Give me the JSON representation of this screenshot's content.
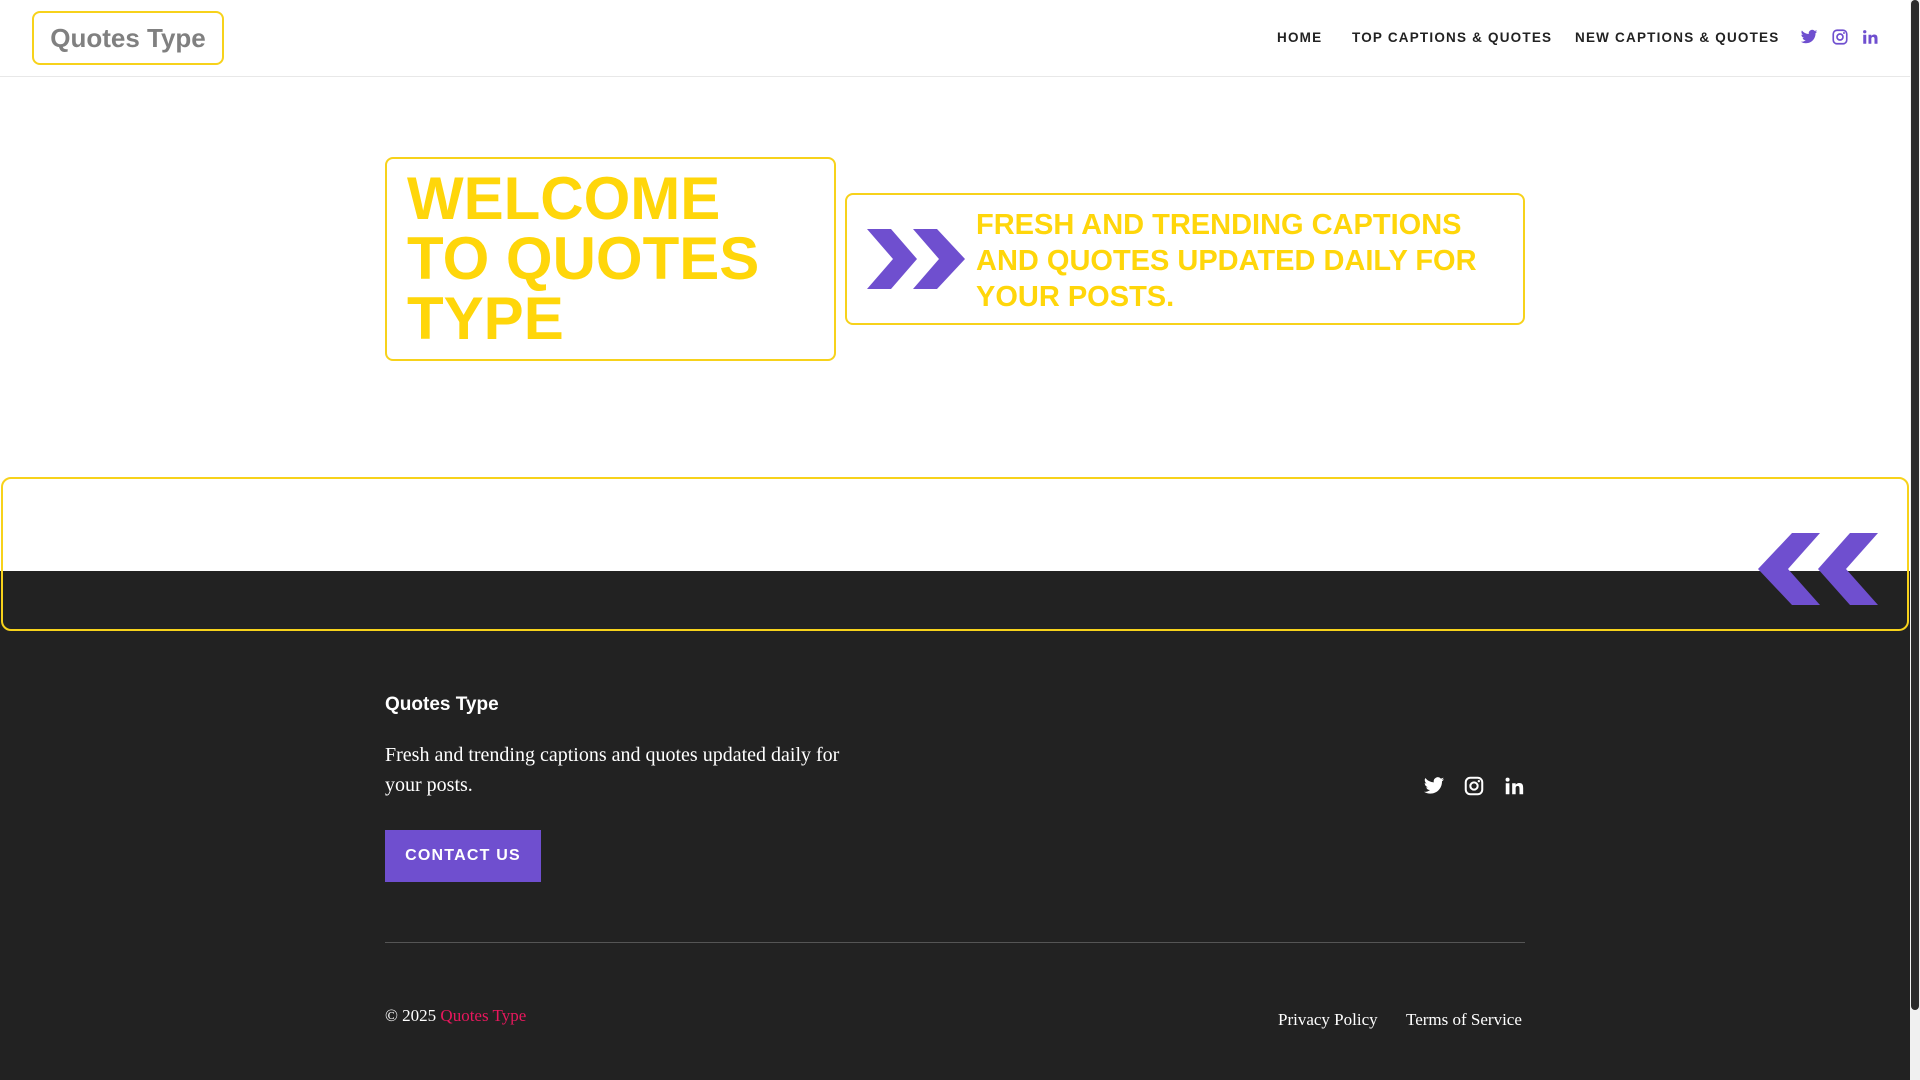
{
  "header": {
    "logo_text": "Quotes Type",
    "nav": [
      {
        "label": "HOME"
      },
      {
        "label": "TOP CAPTIONS & QUOTES"
      },
      {
        "label": "NEW CAPTIONS & QUOTES"
      }
    ],
    "social_icons": [
      "twitter-icon",
      "instagram-icon",
      "linkedin-icon"
    ],
    "social_color": "#6f4fcf"
  },
  "hero": {
    "title": "WELCOME TO QUOTES TYPE",
    "subtitle": "FRESH AND TRENDING CAPTIONS AND QUOTES UPDATED DAILY FOR YOUR POSTS.",
    "title_color": "#ffd60a",
    "border_color": "#f7d21b",
    "arrow_icon": "double-chevron-right-icon",
    "arrow_color": "#6f4fcf"
  },
  "banner": {
    "arrow_icon": "double-chevron-left-icon"
  },
  "footer": {
    "title": "Quotes Type",
    "description": "Fresh and trending captions and quotes updated daily for your posts.",
    "contact_label": "CONTACT US",
    "social_icons": [
      "twitter-icon",
      "instagram-icon",
      "linkedin-icon"
    ],
    "copyright_prefix": "© 2025",
    "copyright_brand": "Quotes Type",
    "brand_color": "#e8175d",
    "links": [
      {
        "label": "Privacy Policy"
      },
      {
        "label": "Terms of Service"
      }
    ],
    "background": "#222222"
  }
}
